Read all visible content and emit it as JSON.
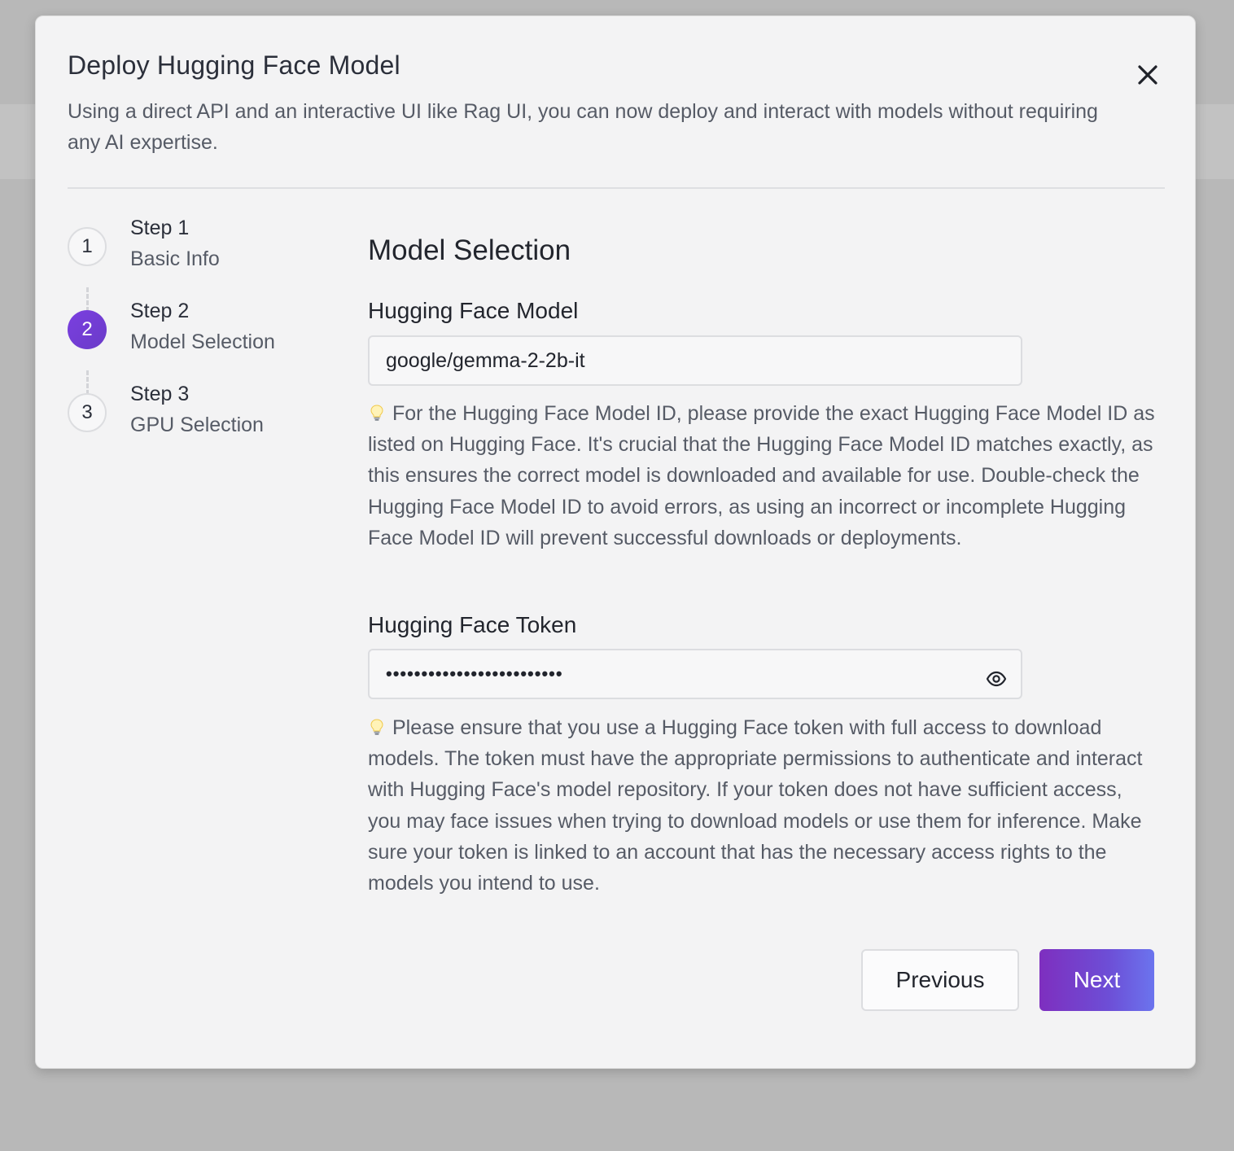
{
  "modal": {
    "title": "Deploy Hugging Face Model",
    "description": "Using a direct API and an interactive UI like Rag UI, you can now deploy and interact with models without requiring any AI expertise.",
    "close_icon": "close-icon"
  },
  "stepper": {
    "current_step": 2,
    "steps": [
      {
        "number": "1",
        "title": "Step 1",
        "subtitle": "Basic Info",
        "state": "inactive"
      },
      {
        "number": "2",
        "title": "Step 2",
        "subtitle": "Model Selection",
        "state": "active"
      },
      {
        "number": "3",
        "title": "Step 3",
        "subtitle": "GPU Selection",
        "state": "inactive"
      }
    ]
  },
  "form": {
    "section_title": "Model Selection",
    "model": {
      "label": "Hugging Face Model",
      "value": "google/gemma-2-2b-it",
      "hint_icon": "lightbulb-icon",
      "hint": "For the Hugging Face Model ID, please provide the exact Hugging Face Model ID as listed on Hugging Face. It's crucial that the Hugging Face Model ID matches exactly, as this ensures the correct model is downloaded and available for use. Double-check the Hugging Face Model ID to avoid errors, as using an incorrect or incomplete Hugging Face Model ID will prevent successful downloads or deployments."
    },
    "token": {
      "label": "Hugging Face Token",
      "masked_value": "•••••••••••••••••••••••••",
      "toggle_icon": "eye-icon",
      "hint_icon": "lightbulb-icon",
      "hint": "Please ensure that you use a Hugging Face token with full access to download models. The token must have the appropriate permissions to authenticate and interact with Hugging Face's model repository. If your token does not have sufficient access, you may face issues when trying to download models or use them for inference. Make sure your token is linked to an account that has the necessary access rights to the models you intend to use."
    }
  },
  "actions": {
    "previous_label": "Previous",
    "next_label": "Next"
  },
  "colors": {
    "accent_start": "#7e2fbf",
    "accent_end": "#6b74ee",
    "active_step": "#7b3fe0",
    "modal_background": "#f3f3f4",
    "overlay": "#b8b8b8"
  }
}
